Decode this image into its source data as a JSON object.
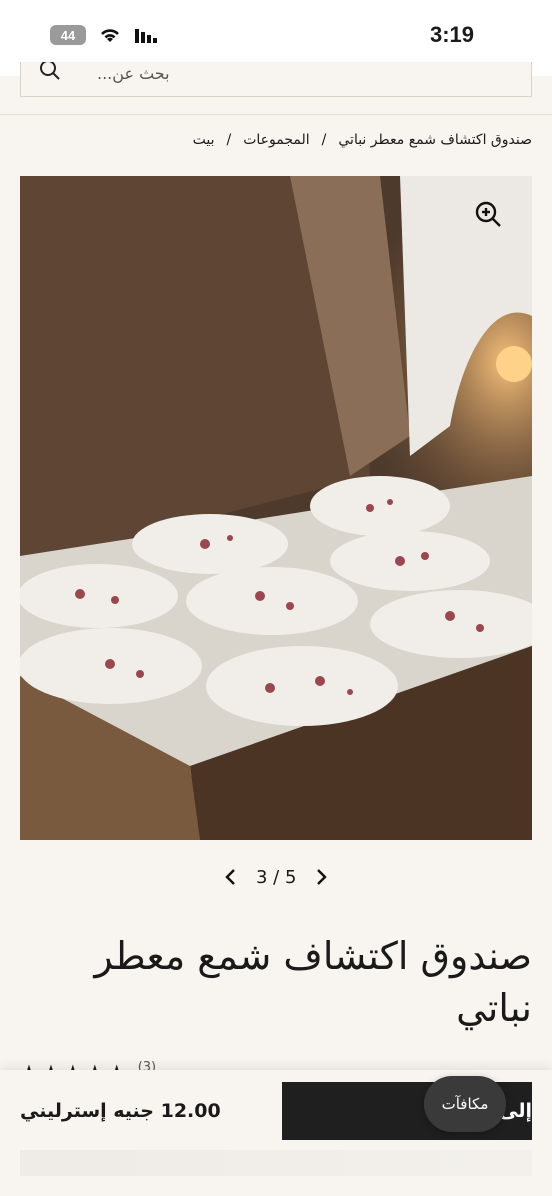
{
  "status_bar": {
    "time": "3:19",
    "battery": "44"
  },
  "search": {
    "placeholder": "بحث عن..."
  },
  "breadcrumb": {
    "home": "بيت",
    "sep1": "/",
    "collections": "المجموعات",
    "sep2": "/",
    "current": "صندوق اكتشاف شمع معطر نباتي"
  },
  "gallery": {
    "counter": "3 / 5"
  },
  "product": {
    "title_line1": "صندوق اكتشاف شمع معطر",
    "title_line2": "نباتي",
    "rating_count": "(3)"
  },
  "purchase": {
    "price": "12.00 جنيه إسترليني",
    "add_to_cart": "إلى السلة",
    "rewards": "مكافآت"
  },
  "icons": [
    "search-icon",
    "zoom-icon",
    "chevron-left-icon",
    "chevron-right-icon",
    "wifi-icon",
    "signal-icon",
    "star-icon"
  ]
}
